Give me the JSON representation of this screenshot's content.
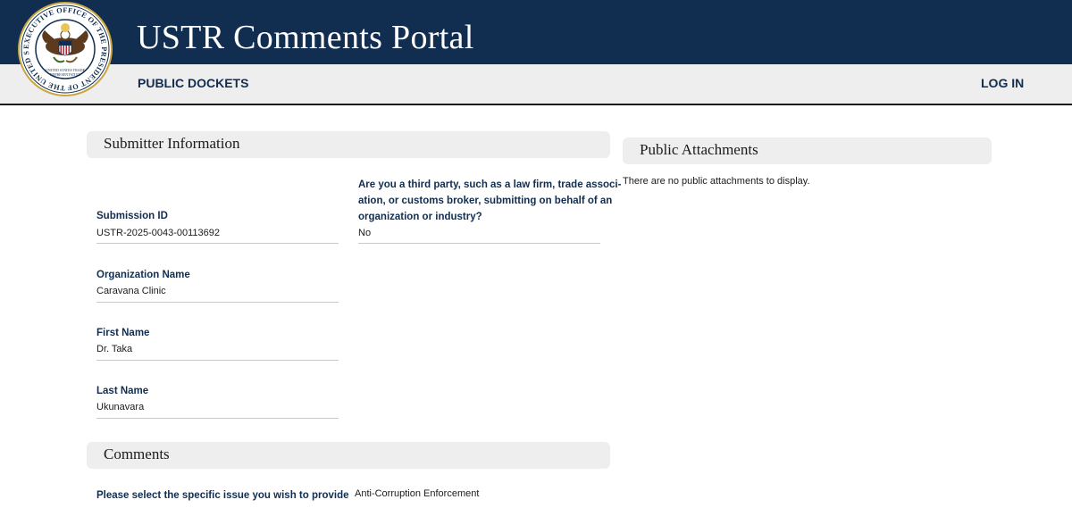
{
  "header": {
    "title": "USTR Comments Portal",
    "seal_name": "seal-icon",
    "seal_text": "EXECUTIVE OFFICE OF THE PRESIDENT OF THE UNITED STATES · UNITED STATES TRADE REPRESENTATIVE"
  },
  "nav": {
    "dockets": "PUBLIC DOCKETS",
    "login": "LOG IN"
  },
  "submitter": {
    "heading": "Submitter Information",
    "submission_id_label": "Submission ID",
    "submission_id_value": "USTR-2025-0043-00113692",
    "org_label": "Organization Name",
    "org_value": "Caravana Clinic",
    "first_label": "First Name",
    "first_value": "Dr. Taka",
    "last_label": "Last Name",
    "last_value": "Ukunavara",
    "third_party_label_1": "Are you a third party, such as a law firm, trade associ-",
    "third_party_label_2": "ation, or customs broker, submitting on behalf of an",
    "third_party_label_3": "organization or industry?",
    "third_party_value": "No"
  },
  "attachments": {
    "heading": "Public Attachments",
    "empty_text": "There are no public attachments to display."
  },
  "comments": {
    "heading": "Comments",
    "issue_label": "Please select the specific issue you wish to provide",
    "issue_value": "Anti-Corruption Enforcement"
  },
  "colors": {
    "navy": "#112e51",
    "panel_gray": "#eeeeee"
  }
}
